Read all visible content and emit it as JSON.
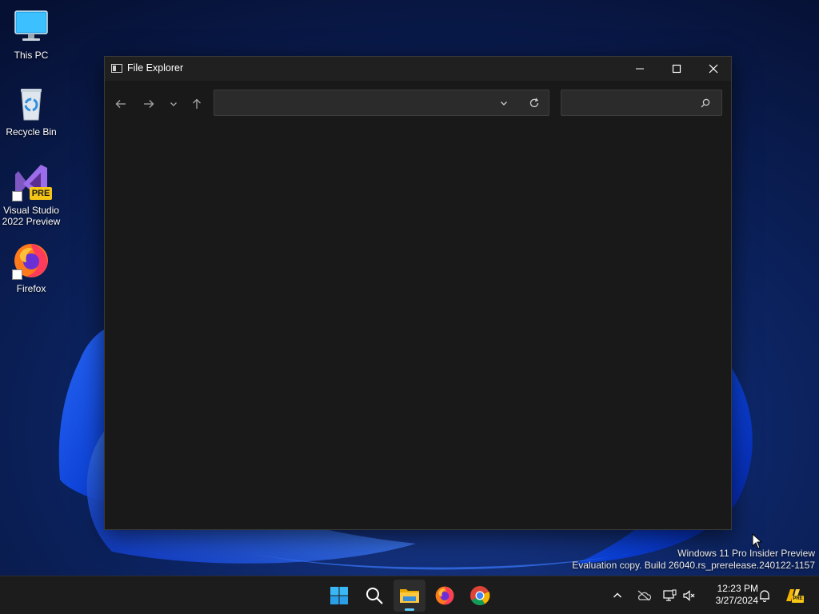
{
  "desktop": {
    "icons": [
      {
        "label": "This PC",
        "icon": "monitor-icon"
      },
      {
        "label": "Recycle Bin",
        "icon": "recycle-bin-icon"
      },
      {
        "label": "Visual Studio 2022 Preview",
        "icon": "visual-studio-icon",
        "badge": "PRE"
      },
      {
        "label": "Firefox",
        "icon": "firefox-icon"
      }
    ]
  },
  "window": {
    "title": "File Explorer",
    "address_value": "",
    "search_placeholder": "",
    "controls": [
      "minimize-icon",
      "maximize-icon",
      "close-icon"
    ],
    "nav": [
      "back-arrow-icon",
      "forward-arrow-icon",
      "recent-dropdown-icon",
      "up-arrow-icon"
    ]
  },
  "watermark": {
    "line1": "Windows 11 Pro Insider Preview",
    "line2": "Evaluation copy. Build 26040.rs_prerelease.240122-1157"
  },
  "taskbar": {
    "apps": [
      "start-icon",
      "search-icon",
      "file-explorer-icon",
      "firefox-icon",
      "chrome-icon"
    ],
    "active_app": "file-explorer-icon",
    "tray": [
      "chevron-up-icon",
      "onedrive-icon",
      "network-icon",
      "volume-muted-icon",
      "notification-bell-icon",
      "copilot-icon"
    ],
    "copilot_badge": "PRE",
    "time": "12:23 PM",
    "date": "3/27/2024"
  },
  "colors": {
    "accent": "#60cdff",
    "window_bg": "#191919",
    "taskbar_bg": "#1c1c1c"
  }
}
